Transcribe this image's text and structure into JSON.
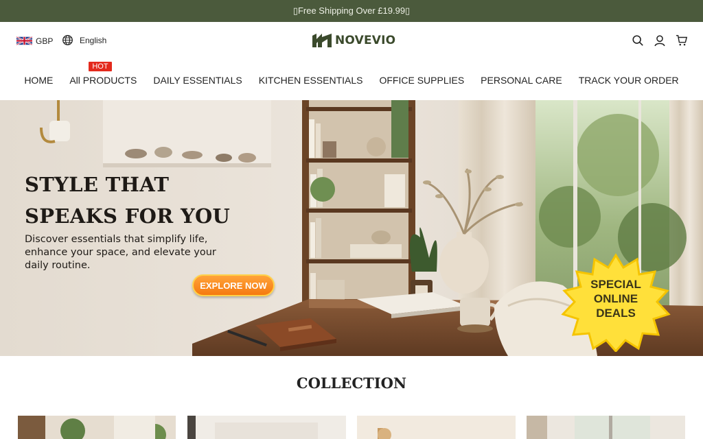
{
  "announcement": {
    "text": "▯Free Shipping Over £19.99▯"
  },
  "header": {
    "currency": {
      "label": "GBP",
      "flag_icon": "uk-flag-icon"
    },
    "language": {
      "label": "English",
      "icon": "globe-icon"
    },
    "logo_text": "NOVEVIO",
    "icons": [
      "search-icon",
      "account-icon",
      "cart-icon"
    ]
  },
  "nav": {
    "items": [
      {
        "label": "HOME"
      },
      {
        "label": "All PRODUCTS",
        "badge": "HOT"
      },
      {
        "label": "DAILY ESSENTIALS"
      },
      {
        "label": "KITCHEN ESSENTIALS"
      },
      {
        "label": "OFFICE SUPPLIES"
      },
      {
        "label": "PERSONAL CARE"
      },
      {
        "label": "TRACK YOUR ORDER"
      }
    ]
  },
  "hero": {
    "title_line1": "STYLE THAT",
    "title_line2": "SPEAKS FOR YOU",
    "subtitle": "Discover essentials that simplify life, enhance your space, and elevate your daily routine.",
    "cta_label": "EXPLORE NOW",
    "badge_line1": "SPECIAL",
    "badge_line2": "ONLINE",
    "badge_line3": "DEALS"
  },
  "collection": {
    "title": "COLLECTION",
    "card_count": 4
  },
  "colors": {
    "announcement_bg": "#4b5a3c",
    "brand": "#3b4a2c",
    "hot_badge": "#e32a1d",
    "cta": "#f57a10",
    "deal_badge": "#ffe03a"
  }
}
